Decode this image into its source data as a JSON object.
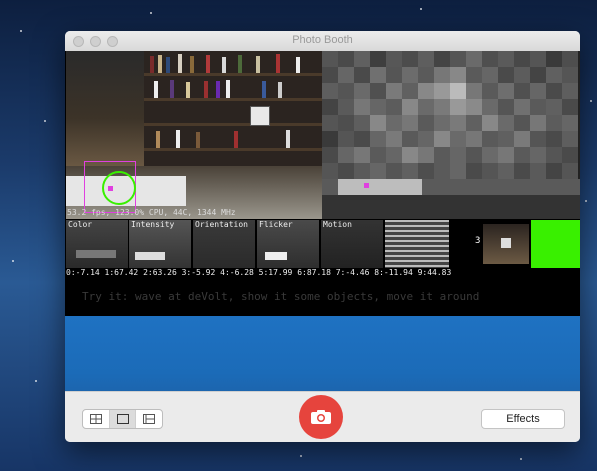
{
  "window": {
    "title": "Photo Booth"
  },
  "overlay": {
    "stats": "53.2 fps, 123.0% CPU, 44C, 1344 MHz",
    "panels": [
      "Color",
      "Intensity",
      "Orientation",
      "Flicker",
      "Motion"
    ],
    "channel_values": "0:-7.14 1:67.42 2:63.26 3:-5.92 4:-6.28 5:17.99 6:87.18 7:-4.46 8:-11.94 9:44.83",
    "marker_number": "3",
    "instruction": "Try it: wave at deVolt, show it some objects, move it around"
  },
  "toolbar": {
    "layout_modes": [
      "grid-view-icon",
      "single-view-icon",
      "filmstrip-view-icon"
    ],
    "selected_layout": 1,
    "shutter_icon": "camera-icon",
    "effects_label": "Effects"
  },
  "colors": {
    "accent_green": "#39f000",
    "shutter_red": "#e6443d",
    "highlight_magenta": "#e040e0"
  }
}
